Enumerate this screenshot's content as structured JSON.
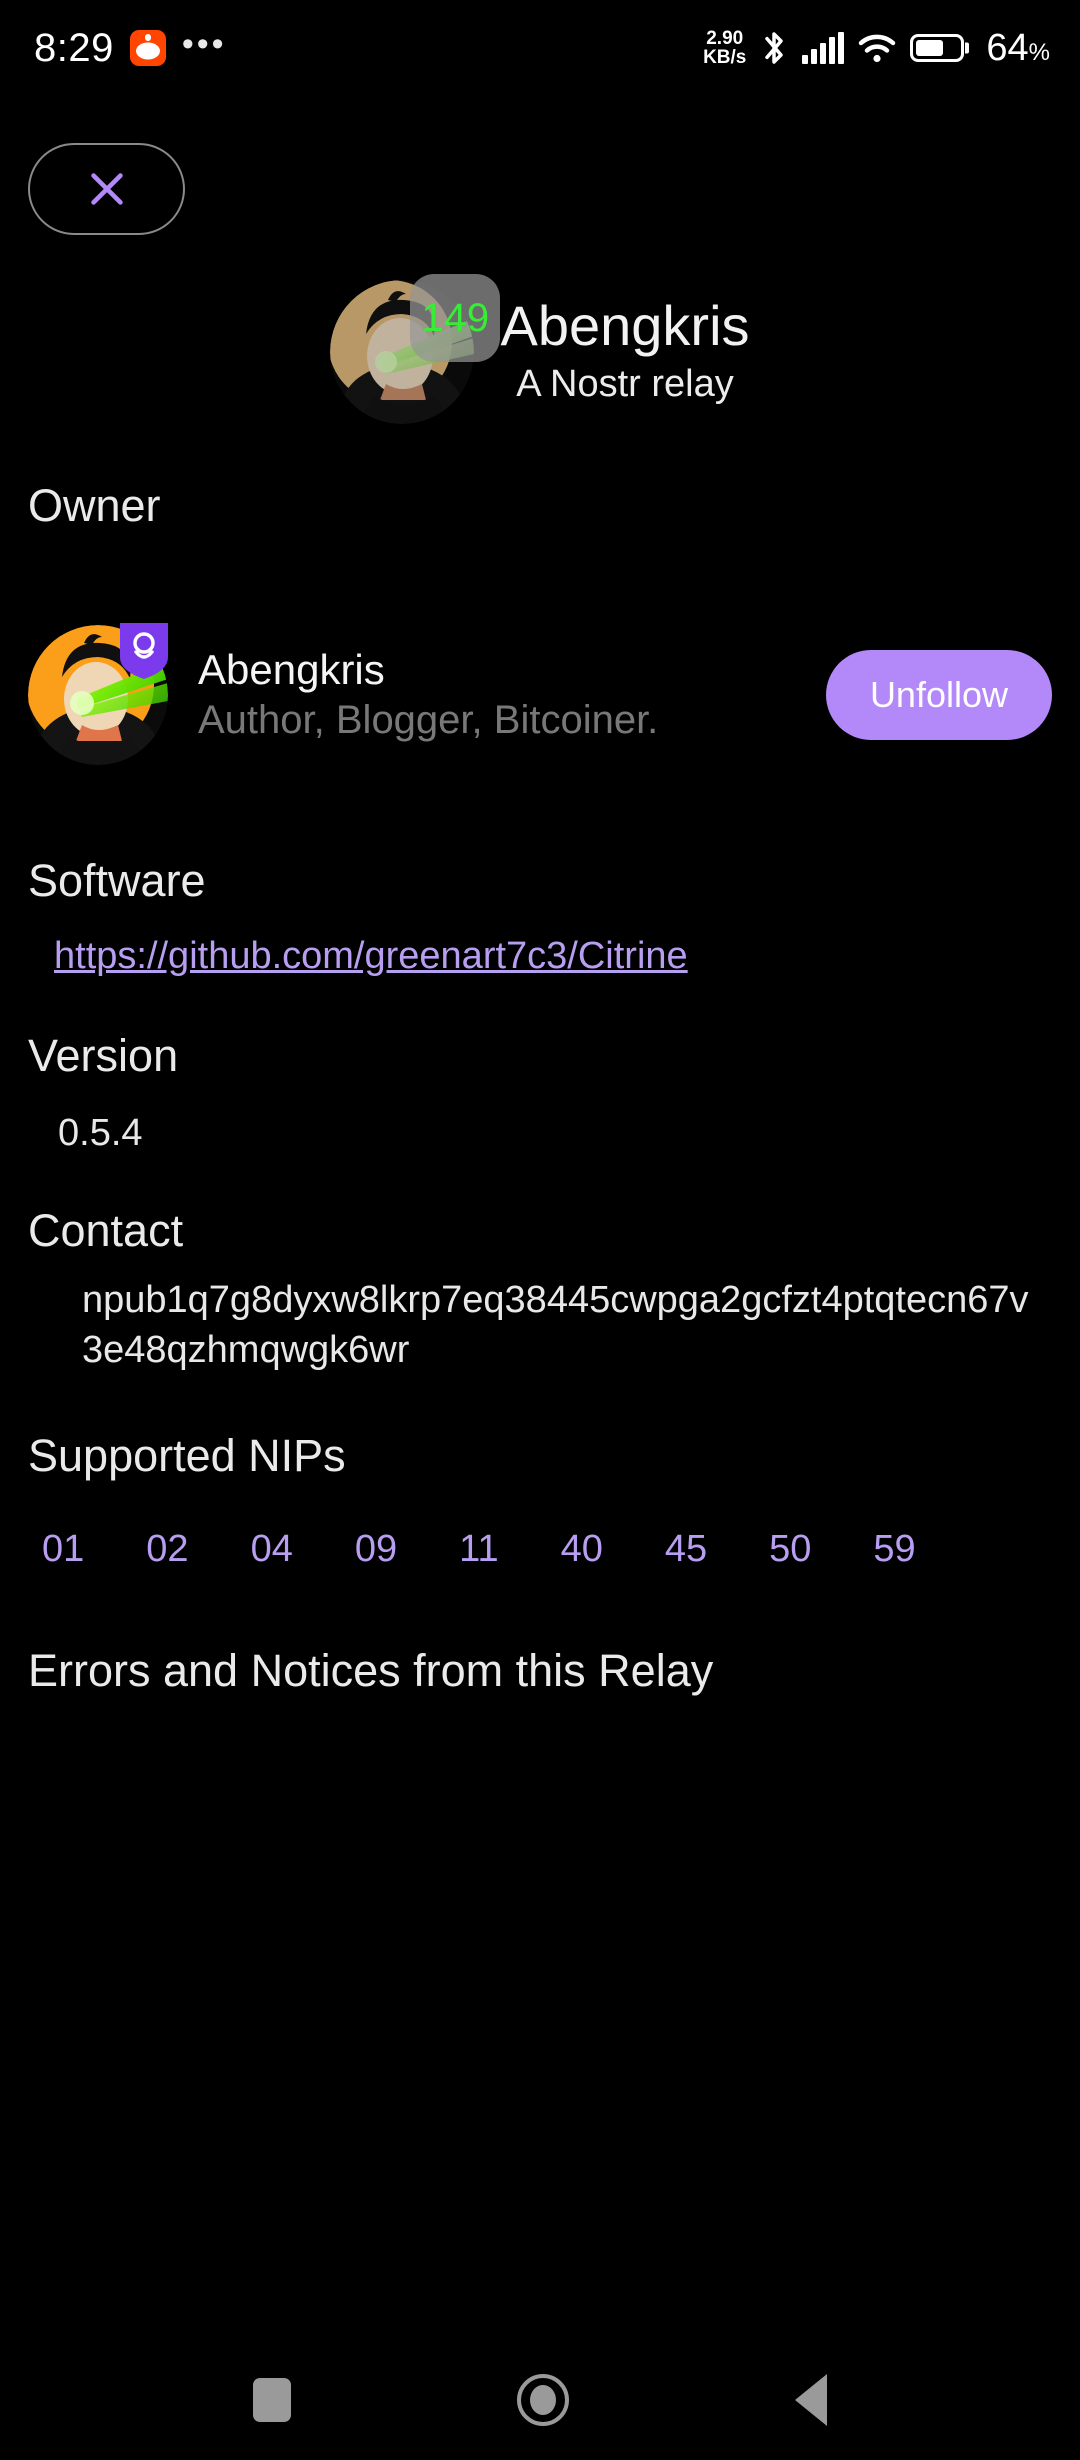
{
  "status_bar": {
    "time": "8:29",
    "app_icon": "reddit-icon",
    "overflow": "•••",
    "net_speed_value": "2.90",
    "net_speed_unit": "KB/s",
    "bluetooth_icon": "bluetooth-icon",
    "signal_icon": "cellular-signal-icon",
    "wifi_icon": "wifi-icon",
    "battery_percent": "64",
    "battery_percent_symbol": "%",
    "battery_level": 64
  },
  "close_button": {
    "icon": "close-x-icon",
    "label": ""
  },
  "relay": {
    "name": "Abengkris",
    "description": "A Nostr relay",
    "badge_count": "149",
    "badge_color": "#35ee35"
  },
  "owner_section": {
    "title": "Owner",
    "name": "Abengkris",
    "bio": "Author, Blogger, Bitcoiner.",
    "follow_button_label": "Unfollow",
    "follow_button_color": "#b388f8",
    "verified_badge_icon": "nostr-verified-badge-icon"
  },
  "software_section": {
    "title": "Software",
    "url": "https://github.com/greenart7c3/Citrine",
    "link_color": "#b79ef0"
  },
  "version_section": {
    "title": "Version",
    "value": "0.5.4"
  },
  "contact_section": {
    "title": "Contact",
    "value": "npub1q7g8dyxw8lkrp7eq38445cwpga2gcfzt4ptqtecn67v3e48qzhmqwgk6wr"
  },
  "nips_section": {
    "title": "Supported NIPs",
    "items": [
      "01",
      "02",
      "04",
      "09",
      "11",
      "40",
      "45",
      "50",
      "59"
    ]
  },
  "errors_section": {
    "title": "Errors and Notices from this Relay",
    "items": []
  },
  "nav_bar": {
    "recents_label": "recents-square-icon",
    "home_label": "home-circle-icon",
    "back_label": "back-triangle-icon"
  }
}
